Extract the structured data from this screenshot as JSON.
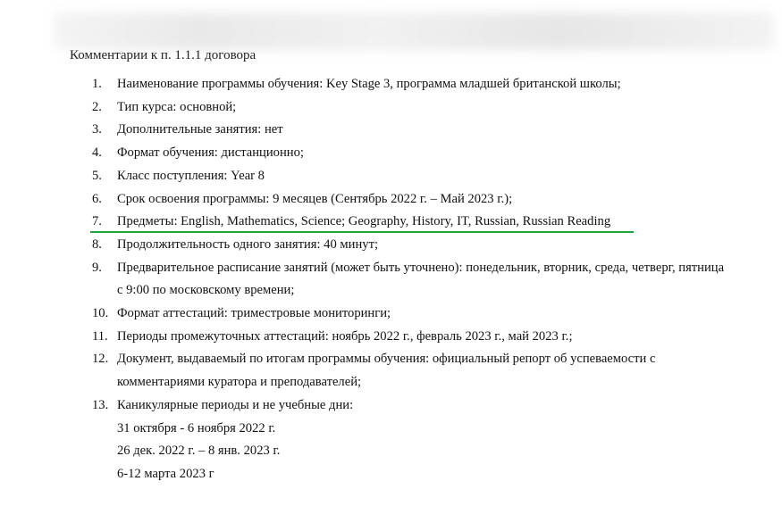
{
  "heading": "Комментарии к п. 1.1.1 договора",
  "items": [
    {
      "num": "1.",
      "lines": [
        "Наименование программы обучения: Key Stage 3, программа младшей британской школы;"
      ]
    },
    {
      "num": "2.",
      "lines": [
        "Тип курса: основной;"
      ]
    },
    {
      "num": "3.",
      "lines": [
        "Дополнительные занятия: нет"
      ]
    },
    {
      "num": "4.",
      "lines": [
        "Формат обучения: дистанционно;"
      ]
    },
    {
      "num": "5.",
      "lines": [
        "Класс поступления: Year 8"
      ]
    },
    {
      "num": "6.",
      "lines": [
        "Срок освоения программы: 9 месяцев (Сентябрь 2022 г. – Май 2023 г.);"
      ]
    },
    {
      "num": "7.",
      "lines": [
        "Предметы: English, Mathematics, Science; Geography, History, IT, Russian, Russian Reading"
      ]
    },
    {
      "num": "8.",
      "lines": [
        "Продолжительность одного занятия: 40 минут;"
      ]
    },
    {
      "num": "9.",
      "lines": [
        "Предварительное расписание занятий (может быть уточнено): понедельник, вторник, среда, четверг, пятница",
        "с 9:00 по московскому времени;"
      ]
    },
    {
      "num": "10.",
      "lines": [
        "Формат аттестаций: триместровые мониторинги;"
      ]
    },
    {
      "num": "11.",
      "lines": [
        "Периоды промежуточных аттестаций: ноябрь 2022 г., февраль 2023 г., май 2023 г.;"
      ]
    },
    {
      "num": "12.",
      "lines": [
        "Документ, выдаваемый по итогам программы обучения: официальный репорт об успеваемости с",
        "комментариями куратора и преподавателей;"
      ]
    },
    {
      "num": "13.",
      "lines": [
        "Каникулярные периоды и не учебные дни:"
      ]
    }
  ],
  "holidays": [
    "31 октября - 6 ноября 2022 г.",
    "26 дек. 2022 г. – 8 янв. 2023 г.",
    "6-12 марта 2023 г"
  ],
  "highlight_color": "#1aa43a"
}
